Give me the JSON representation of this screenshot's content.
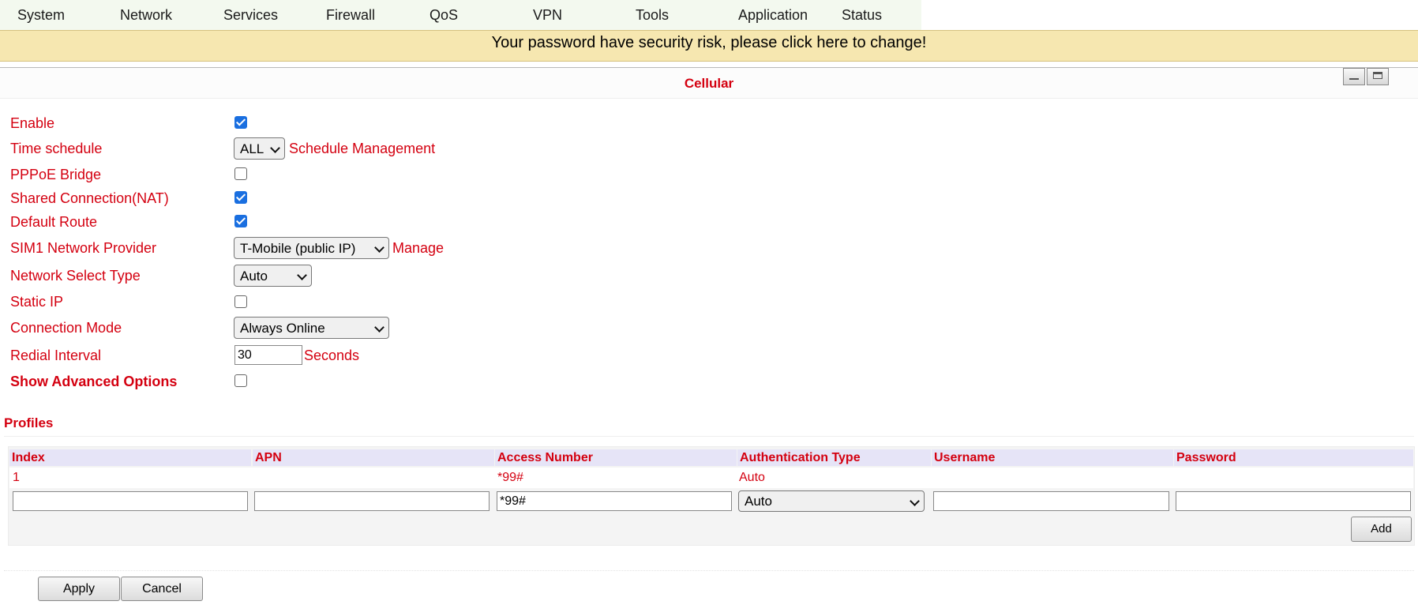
{
  "nav": {
    "items": [
      "System",
      "Network",
      "Services",
      "Firewall",
      "QoS",
      "VPN",
      "Tools",
      "Application",
      "Status"
    ]
  },
  "banner": {
    "text": "Your password have security risk, please click here to change!"
  },
  "panel": {
    "title": "Cellular"
  },
  "form": {
    "enable": {
      "label": "Enable",
      "checked": true
    },
    "time_schedule": {
      "label": "Time schedule",
      "value": "ALL",
      "link": "Schedule Management"
    },
    "pppoe_bridge": {
      "label": "PPPoE Bridge",
      "checked": false
    },
    "shared_connection": {
      "label": "Shared Connection(NAT)",
      "checked": true
    },
    "default_route": {
      "label": "Default Route",
      "checked": true
    },
    "sim1_provider": {
      "label": "SIM1 Network Provider",
      "value": "T-Mobile (public IP)",
      "link": "Manage"
    },
    "network_select_type": {
      "label": "Network Select Type",
      "value": "Auto"
    },
    "static_ip": {
      "label": "Static IP",
      "checked": false
    },
    "connection_mode": {
      "label": "Connection Mode",
      "value": "Always Online"
    },
    "redial_interval": {
      "label": "Redial Interval",
      "value": "30",
      "unit": "Seconds"
    },
    "show_advanced": {
      "label": "Show Advanced Options",
      "checked": false
    }
  },
  "profiles": {
    "title": "Profiles",
    "columns": [
      "Index",
      "APN",
      "Access Number",
      "Authentication Type",
      "Username",
      "Password"
    ],
    "rows": [
      {
        "index": "1",
        "apn": "",
        "access_number": "*99#",
        "auth_type": "Auto",
        "username": "",
        "password": ""
      }
    ],
    "new_row": {
      "index": "",
      "apn": "",
      "access_number": "*99#",
      "auth_type": "Auto",
      "username": "",
      "password": ""
    },
    "add_label": "Add"
  },
  "actions": {
    "apply": "Apply",
    "cancel": "Cancel"
  },
  "colors": {
    "accent": "#d40010",
    "checkbox": "#1a6fe0",
    "banner_bg": "#f6e7b0",
    "nav_bg": "#f3f9ef",
    "header_bg": "#e6e4f7"
  }
}
